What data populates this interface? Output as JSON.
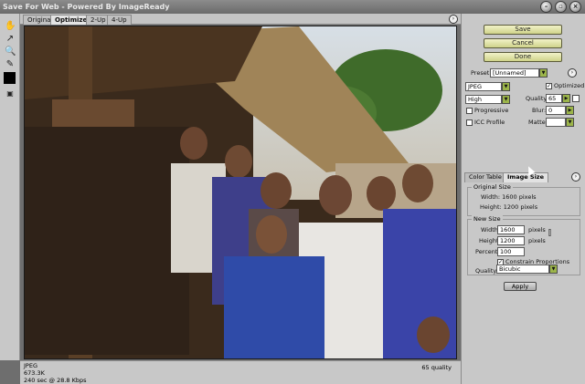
{
  "window": {
    "title": "Save For Web - Powered By ImageReady"
  },
  "view_tabs": [
    "Original",
    "Optimized",
    "2-Up",
    "4-Up"
  ],
  "actions": {
    "save": "Save",
    "cancel": "Cancel",
    "done": "Done"
  },
  "settings": {
    "preset_label": "Preset:",
    "preset_value": "[Unnamed]",
    "format": "JPEG",
    "quality_level": "High",
    "optimized_label": "Optimized",
    "optimized_checked": true,
    "progressive_label": "Progressive",
    "progressive_checked": false,
    "icc_label": "ICC Profile",
    "icc_checked": false,
    "quality_label": "Quality:",
    "quality_value": "65",
    "blur_label": "Blur:",
    "blur_value": "0",
    "matte_label": "Matte:"
  },
  "panel_tabs": [
    "Color Table",
    "Image Size"
  ],
  "image_size": {
    "original_title": "Original Size",
    "orig_width": "Width: 1600 pixels",
    "orig_height": "Height: 1200 pixels",
    "new_title": "New Size",
    "width_label": "Width:",
    "width_value": "1600",
    "height_label": "Height:",
    "height_value": "1200",
    "percent_label": "Percent:",
    "percent_value": "100",
    "unit": "pixels",
    "constrain_label": "Constrain Proportions",
    "constrain_checked": true,
    "quality_label": "Quality:",
    "quality_value": "Bicubic",
    "apply": "Apply"
  },
  "status": {
    "format": "JPEG",
    "size": "673.3K",
    "time": "240 sec @ 28.8 Kbps",
    "quality": "65 quality"
  }
}
